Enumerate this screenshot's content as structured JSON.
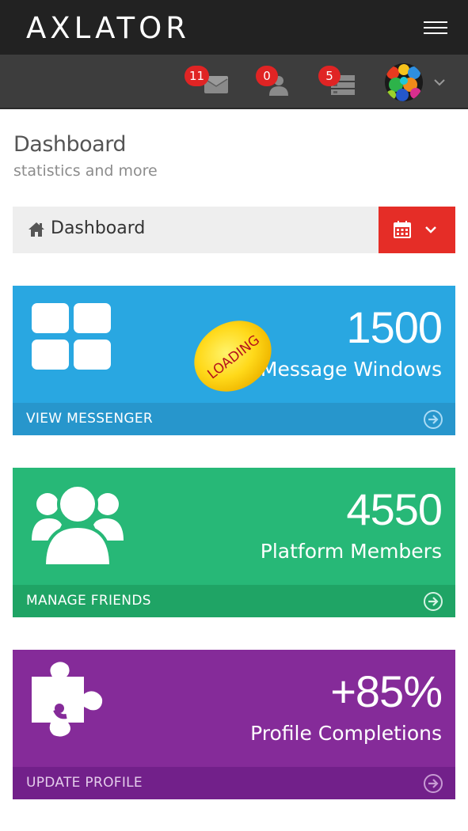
{
  "app": {
    "brand": "AXLATOR"
  },
  "colors": {
    "header_bg": "#222222",
    "notif_bg": "#3d3d3d",
    "badge": "#e02424",
    "date_button": "#e52d27",
    "messenger_card": "#29a7e1",
    "messenger_footer": "#2796cc",
    "members_card": "#27b877",
    "members_footer": "#1fa465",
    "profile_card": "#852b99",
    "profile_footer": "#72208a"
  },
  "notifications": [
    {
      "icon": "envelope-icon",
      "count": "11"
    },
    {
      "icon": "user-icon",
      "count": "0"
    },
    {
      "icon": "tasks-icon",
      "count": "5"
    }
  ],
  "page": {
    "title": "Dashboard",
    "subtitle": "statistics and more"
  },
  "breadcrumb": {
    "label": "Dashboard"
  },
  "cards": [
    {
      "icon": "grid-icon",
      "number": "1500",
      "desc": "Message Windows",
      "link": "VIEW MESSENGER"
    },
    {
      "icon": "group-icon",
      "number": "4550",
      "desc": "Platform Members",
      "link": "MANAGE FRIENDS"
    },
    {
      "icon": "puzzle-icon",
      "number": "+85%",
      "desc": "Profile Completions",
      "link": "UPDATE PROFILE"
    }
  ],
  "loading": {
    "label": "LOADING"
  }
}
